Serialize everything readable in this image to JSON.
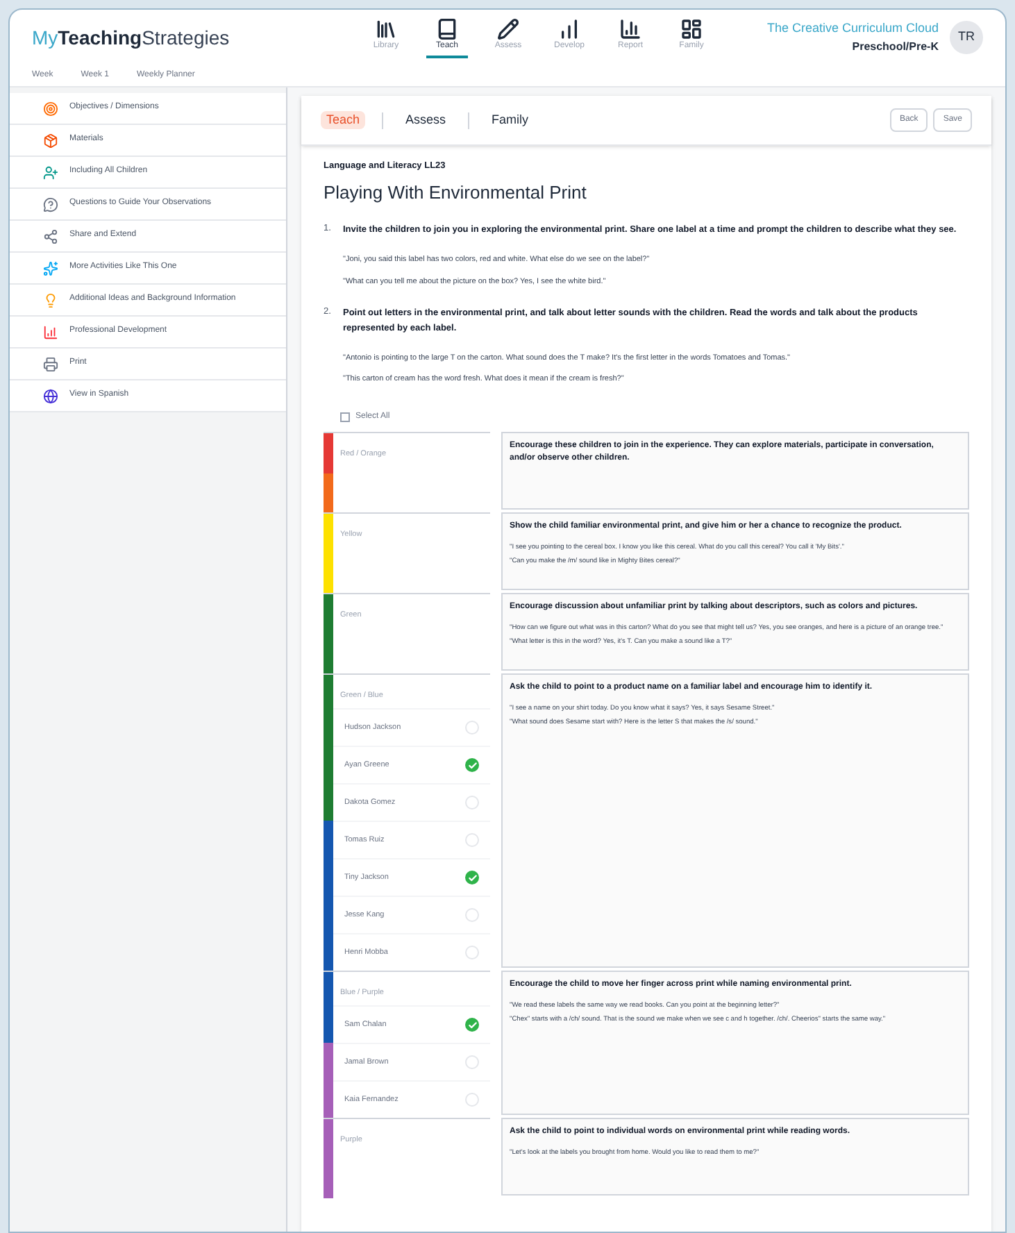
{
  "brand": {
    "light": "My",
    "bold": "Teaching",
    "rest": "Strategies"
  },
  "nav": [
    {
      "label": "Library",
      "selected": false
    },
    {
      "label": "Teach",
      "selected": true
    },
    {
      "label": "Assess",
      "selected": false
    },
    {
      "label": "Develop",
      "selected": false
    },
    {
      "label": "Report",
      "selected": false
    },
    {
      "label": "Family",
      "selected": false
    }
  ],
  "product": {
    "name": "The Creative Curriculum Cloud",
    "level": "Preschool/Pre-K",
    "avatar": "TR"
  },
  "breadcrumb": [
    "Week",
    "Week 1",
    "Weekly Planner"
  ],
  "sidebar": [
    {
      "label": "Objectives / Dimensions"
    },
    {
      "label": "Materials"
    },
    {
      "label": "Including All Children"
    },
    {
      "label": "Questions to Guide Your Observations"
    },
    {
      "label": "Share and Extend"
    },
    {
      "label": "More Activities Like This One"
    },
    {
      "label": "Additional Ideas and Background Information"
    },
    {
      "label": "Professional Development"
    },
    {
      "label": "Print"
    },
    {
      "label": "View in Spanish"
    }
  ],
  "tabs": [
    {
      "label": "Teach",
      "selected": true
    },
    {
      "label": "Assess",
      "selected": false
    },
    {
      "label": "Family",
      "selected": false
    }
  ],
  "buttons": [
    "Back",
    "Save"
  ],
  "activity": {
    "category": "Language and Literacy LL23",
    "title": "Playing With Environmental Print",
    "steps": [
      {
        "number": "1.",
        "text": "Invite the children to join you in exploring the environmental print. Share one label at a time and prompt the children to describe what they see.",
        "quotes": [
          "\"Joni, you said this label has two colors, red and white. What else do we see on the label?\"",
          "\"What can you tell me about the picture on the box? Yes, I see the white bird.\""
        ]
      },
      {
        "number": "2.",
        "text": "Point out letters in the environmental print, and talk about letter sounds with the children. Read the words and talk about the products represented by each label.",
        "quotes": [
          "\"Antonio is pointing to the large T on the carton. What sound does the T make? It's the first letter in the words Tomatoes and Tomas.\"",
          "\"This carton of cream has the word fresh. What does it mean if the cream is fresh?\""
        ]
      }
    ]
  },
  "select_all": {
    "label": "Select All",
    "checked": false
  },
  "levels": [
    {
      "label": "Red / Orange",
      "bands": [
        {
          "color": "#e53935"
        },
        {
          "color": "#f26a1b"
        }
      ],
      "guidance": "Encourage these children to join in the experience. They can explore materials, participate in conversation, and/or observe other children."
    },
    {
      "label": "Yellow",
      "bands": [
        {
          "color": "#fde100"
        }
      ],
      "guidance": "Show the child familiar environmental print, and give him or her a chance to recognize the product.",
      "quotes": [
        "\"I see you pointing to the cereal box. I know you like this cereal. What do you call this cereal? You call it 'My Bits'.\"",
        "\"Can you make the /m/ sound like in Mighty Bites cereal?\""
      ]
    },
    {
      "label": "Green",
      "bands": [
        {
          "color": "#1e7d32"
        }
      ],
      "guidance": "Encourage discussion about unfamiliar print by talking about descriptors, such as colors and pictures.",
      "quotes": [
        "\"How can we figure out what was in this carton? What do you see that might tell us? Yes, you see oranges, and here is a picture of an orange tree.\"",
        "\"What letter is this in the word? Yes, it's T. Can you make a sound like a T?\""
      ]
    },
    {
      "label": "Green / Blue",
      "bands": [
        {
          "color": "#1e7d32"
        }
      ],
      "guidance": "Ask the child to point to a product name on a familiar label and encourage him to identify it.",
      "quotes": [
        "\"I see a name on your shirt today. Do you know what it says? Yes, it says Sesame Street.\"",
        "\"What sound does Sesame start with? Here is the letter S that makes the /s/ sound.\""
      ],
      "children": [
        {
          "name": "Hudson Jackson",
          "color": "#1e7d32",
          "checked": false
        },
        {
          "name": "Ayan Greene",
          "color": "#1e7d32",
          "checked": true
        },
        {
          "name": "Dakota Gomez",
          "color": "#1e7d32",
          "checked": false
        },
        {
          "name": "Tomas Ruiz",
          "color": "#1557b0",
          "checked": false
        },
        {
          "name": "Tiny Jackson",
          "color": "#1557b0",
          "checked": true
        },
        {
          "name": "Jesse Kang",
          "color": "#1557b0",
          "checked": false
        },
        {
          "name": "Henri Mobba",
          "color": "#1557b0",
          "checked": false
        }
      ]
    },
    {
      "label": "Blue / Purple",
      "bands": [
        {
          "color": "#1557b0"
        }
      ],
      "guidance": "Encourage the child to move her finger across print while naming environmental print.",
      "quotes": [
        "\"We read these labels the same way we read books. Can you point at the beginning letter?\"",
        "\"Chex\" starts with a /ch/ sound. That is the sound we make when we see c and h together. /ch/. Cheerios\" starts the same way.\""
      ],
      "children": [
        {
          "name": "Sam Chalan",
          "color": "#1557b0",
          "checked": true
        },
        {
          "name": "Jamal Brown",
          "color": "#a65fb8",
          "checked": false
        },
        {
          "name": "Kaia Fernandez",
          "color": "#a65fb8",
          "checked": false
        }
      ]
    },
    {
      "label": "Purple",
      "bands": [
        {
          "color": "#a65fb8"
        }
      ],
      "guidance": "Ask the child to point to individual words on environmental print while reading words.",
      "quotes": [
        "\"Let's look at the labels you brought from home. Would you like to read them to me?\""
      ]
    }
  ]
}
